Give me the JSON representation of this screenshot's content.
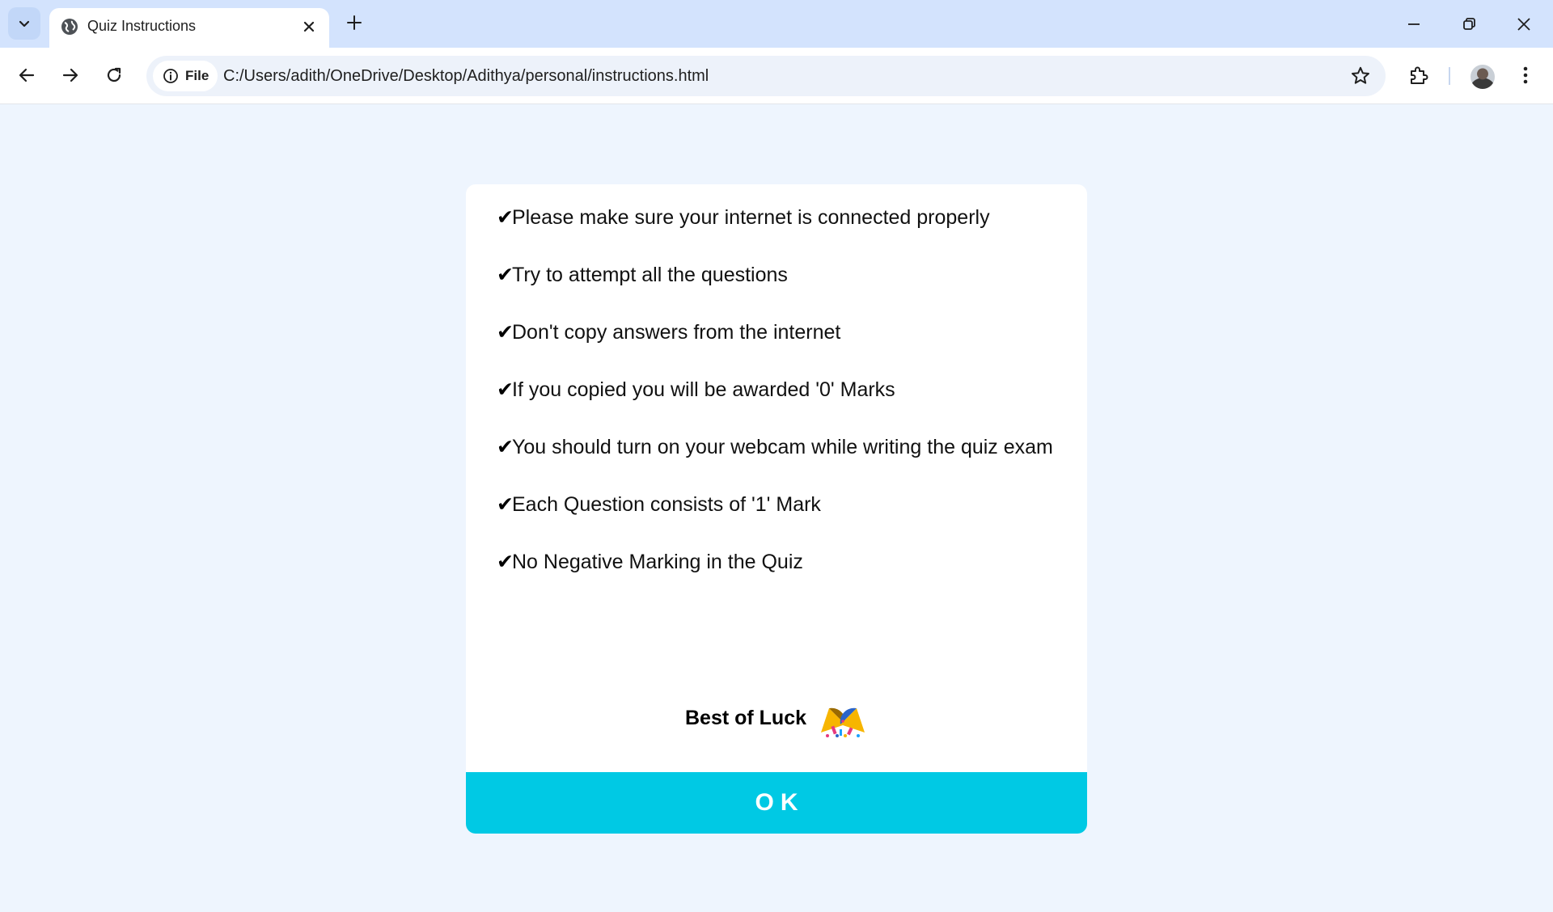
{
  "browser": {
    "tab": {
      "title": "Quiz Instructions"
    },
    "address": {
      "scheme_chip": "File",
      "url": "C:/Users/adith/OneDrive/Desktop/Adithya/personal/instructions.html"
    }
  },
  "quiz": {
    "rules": [
      "Please make sure your internet is connected properly",
      "Try to attempt all the questions",
      "Don't copy answers from the internet",
      "If you copied you will be awarded '0' Marks",
      "You should turn on your webcam while writing the quiz exam",
      "Each Question consists of '1' Mark",
      "No Negative Marking in the Quiz"
    ],
    "check_symbol": "✔",
    "closing": "Best of Luck",
    "ok_label": "OK"
  },
  "icons": {
    "tab_search": "chevron-down-icon",
    "favicon": "globe-icon",
    "tab_close": "close-icon",
    "new_tab": "plus-icon",
    "minimize": "minimize-icon",
    "restore": "restore-icon",
    "close": "close-window-icon",
    "back": "back-arrow-icon",
    "forward": "forward-arrow-icon",
    "reload": "reload-icon",
    "info": "info-icon",
    "bookmark": "star-icon",
    "extensions": "puzzle-icon",
    "menu": "kebab-menu-icon",
    "celebration": "party-popper-icon"
  },
  "colors": {
    "tabstrip": "#d3e3fd",
    "page_background": "#eef5fe",
    "ok_button": "#00c9e4"
  }
}
